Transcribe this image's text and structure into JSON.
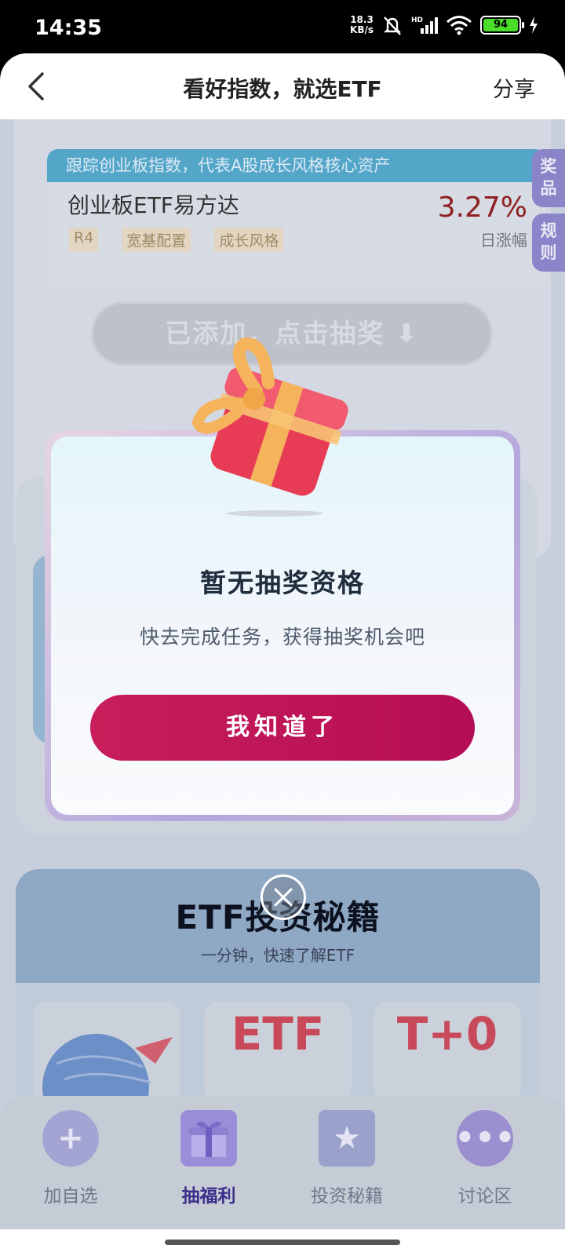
{
  "status_bar": {
    "time": "14:35",
    "net_speed_value": "18.3",
    "net_speed_unit": "KB/s",
    "battery": "94"
  },
  "header": {
    "title": "看好指数，就选ETF",
    "share_label": "分享"
  },
  "fund": {
    "banner": "跟踪创业板指数，代表A股成长风格核心资产",
    "name": "创业板ETF易方达",
    "tags": [
      "R4",
      "宽基配置",
      "成长风格"
    ],
    "change_pct": "3.27%",
    "change_label": "日涨幅"
  },
  "side_tabs": {
    "prize": "奖品",
    "rules": "规则"
  },
  "draw_button": "已添加，点击抽奖 ⬇",
  "secrets": {
    "title": "ETF投资秘籍",
    "subtitle": "一分钟，快速了解ETF",
    "tiles": [
      "",
      "ETF",
      "T+0"
    ]
  },
  "modal": {
    "title": "暂无抽奖资格",
    "description": "快去完成任务，获得抽奖机会吧",
    "confirm_label": "我知道了"
  },
  "bottom_nav": {
    "items": [
      {
        "label": "加自选",
        "icon": "plus-icon"
      },
      {
        "label": "抽福利",
        "icon": "gift-icon",
        "active": true
      },
      {
        "label": "投资秘籍",
        "icon": "book-icon"
      },
      {
        "label": "讨论区",
        "icon": "chat-icon"
      }
    ]
  },
  "colors": {
    "accent": "#c81e5a",
    "nav_active": "#3a2f8a",
    "pct_up": "#c0262a"
  }
}
